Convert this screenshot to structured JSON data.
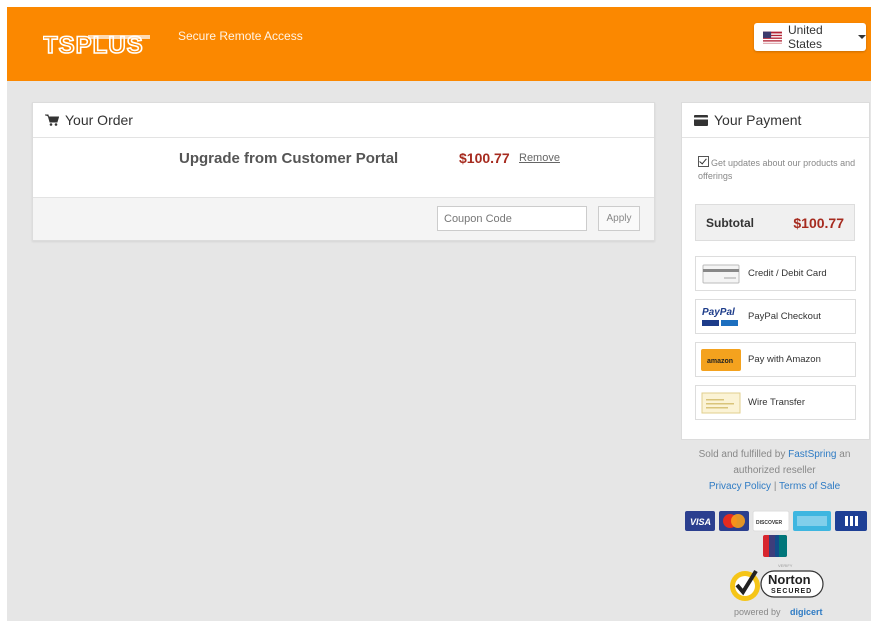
{
  "header": {
    "logo_text": "TSPLUS",
    "tagline": "Secure Remote Access",
    "country": "United States"
  },
  "order": {
    "title": "Your Order",
    "product_name": "Upgrade from Customer Portal",
    "price": "$100.77",
    "remove_label": "Remove",
    "coupon_placeholder": "Coupon Code",
    "apply_label": "Apply"
  },
  "payment": {
    "title": "Your Payment",
    "updates_checked": true,
    "updates_label": "Get updates about our products and offerings",
    "subtotal_label": "Subtotal",
    "subtotal_value": "$100.77",
    "methods": [
      {
        "label": "Credit / Debit Card",
        "icon": "credit-card-icon"
      },
      {
        "label": "PayPal Checkout",
        "icon": "paypal-icon"
      },
      {
        "label": "Pay with Amazon",
        "icon": "amazon-icon"
      },
      {
        "label": "Wire Transfer",
        "icon": "wire-transfer-icon"
      }
    ]
  },
  "footer": {
    "sold_prefix": "Sold and fulfilled by ",
    "sold_link": "FastSpring",
    "sold_suffix": " an authorized reseller",
    "privacy": "Privacy Policy",
    "separator": " | ",
    "terms": "Terms of Sale",
    "card_logos": [
      "VISA",
      "Mastercard",
      "DISCOVER",
      "AMERICAN EXPRESS",
      "JCB",
      "UnionPay"
    ],
    "norton_title": "Norton",
    "norton_secured": "SECURED",
    "norton_verify": "VERIFY",
    "powered_by": "powered by ",
    "digicert": "digicert"
  },
  "colors": {
    "header_bg": "#fb8800",
    "price": "#a62b1f",
    "link": "#2e7bc4"
  }
}
